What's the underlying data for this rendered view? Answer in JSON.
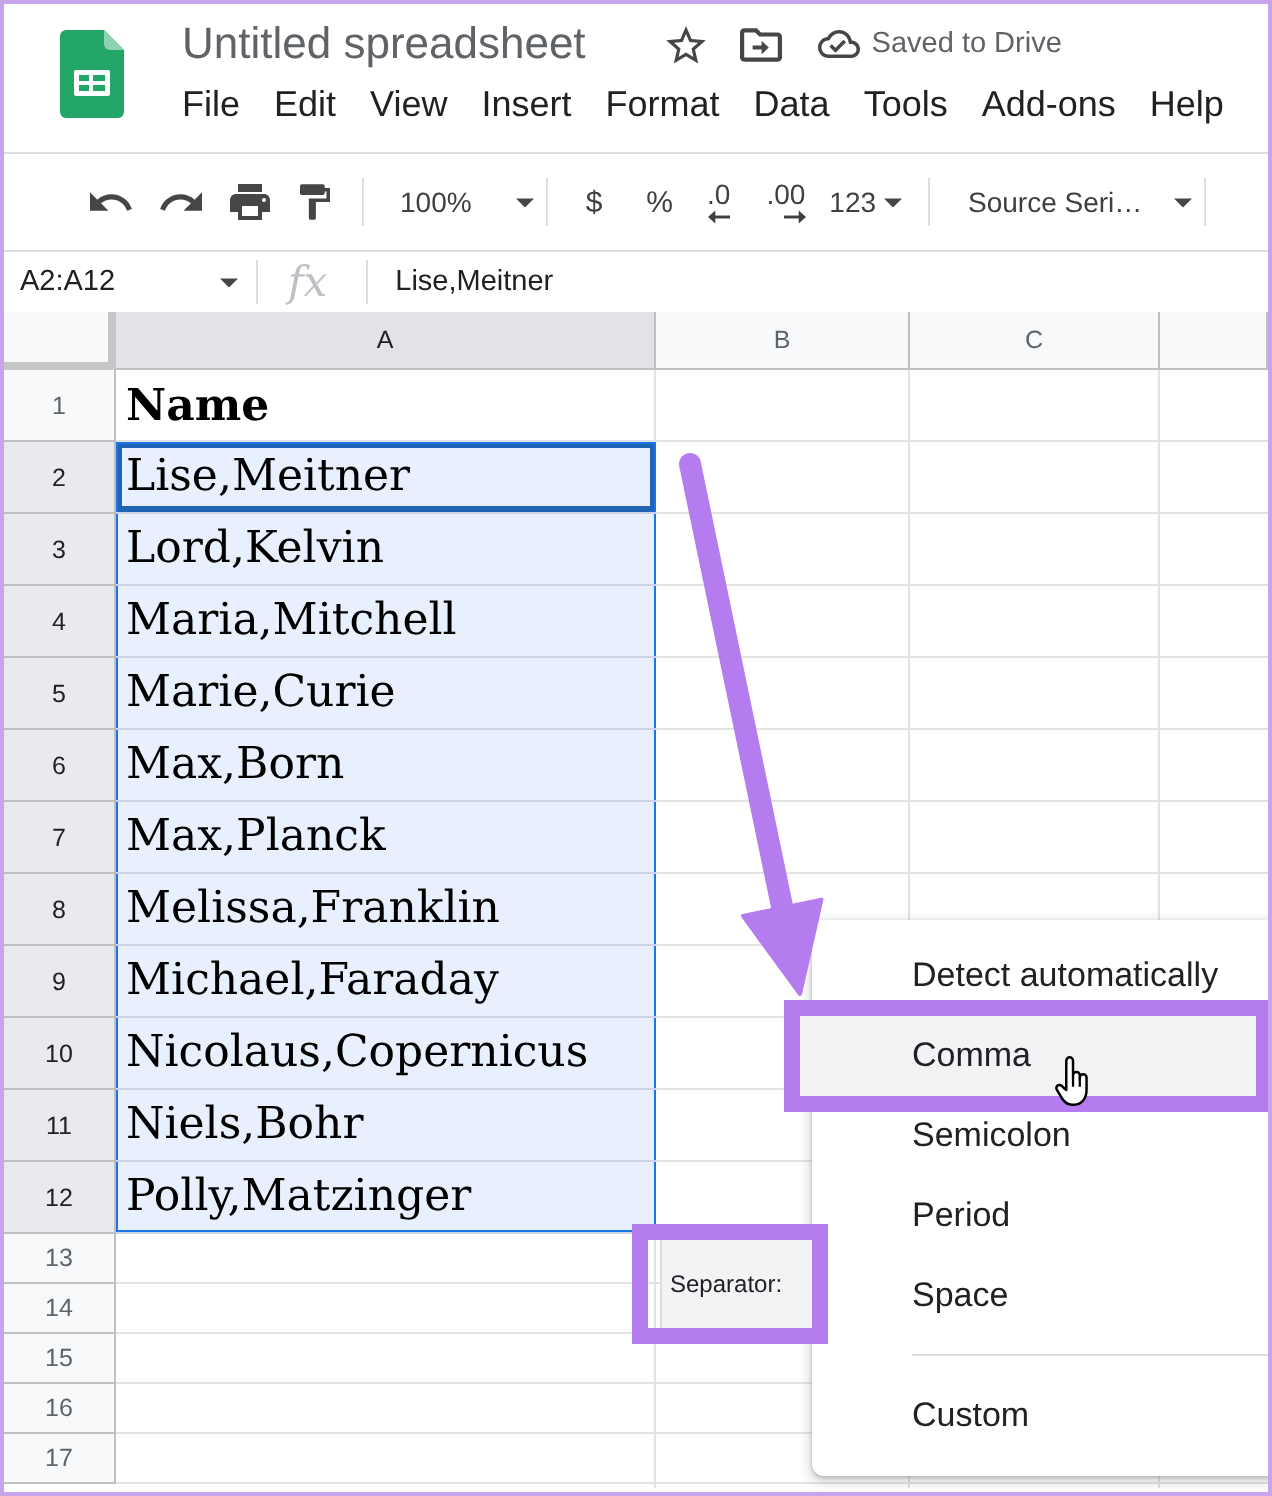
{
  "header": {
    "title": "Untitled spreadsheet",
    "save_status": "Saved to Drive",
    "menu": [
      "File",
      "Edit",
      "View",
      "Insert",
      "Format",
      "Data",
      "Tools",
      "Add-ons",
      "Help"
    ]
  },
  "toolbar": [
    {
      "kind": "undo"
    },
    {
      "kind": "redo"
    },
    {
      "kind": "print"
    },
    {
      "kind": "paint_format"
    },
    {
      "kind": "divider"
    },
    {
      "kind": "zoom",
      "label": "100%"
    },
    {
      "kind": "divider"
    },
    {
      "kind": "text",
      "label": "$"
    },
    {
      "kind": "text",
      "label": "%"
    },
    {
      "kind": "decimal_decrease",
      "label": ".0"
    },
    {
      "kind": "decimal_increase",
      "label": ".00"
    },
    {
      "kind": "number_format",
      "label": "123"
    },
    {
      "kind": "divider"
    },
    {
      "kind": "font",
      "label": "Source Seri…"
    },
    {
      "kind": "divider"
    }
  ],
  "formula_bar": {
    "name_box": "A2:A12",
    "function_label": "fx",
    "formula": "Lise,Meitner"
  },
  "sheet": {
    "columns": [
      {
        "label": "A",
        "selected": true
      },
      {
        "label": "B",
        "selected": false
      },
      {
        "label": "C",
        "selected": false
      }
    ],
    "rows": [
      {
        "label": "1",
        "kind": "header",
        "value": "Name",
        "selected": false,
        "active": false
      },
      {
        "label": "2",
        "kind": "text",
        "value": "Lise,Meitner",
        "selected": true,
        "active": true
      },
      {
        "label": "3",
        "kind": "text",
        "value": "Lord,Kelvin",
        "selected": true,
        "active": false
      },
      {
        "label": "4",
        "kind": "text",
        "value": "Maria,Mitchell",
        "selected": true,
        "active": false
      },
      {
        "label": "5",
        "kind": "text",
        "value": "Marie,Curie",
        "selected": true,
        "active": false
      },
      {
        "label": "6",
        "kind": "text",
        "value": "Max,Born",
        "selected": true,
        "active": false
      },
      {
        "label": "7",
        "kind": "text",
        "value": "Max,Planck",
        "selected": true,
        "active": false
      },
      {
        "label": "8",
        "kind": "text",
        "value": "Melissa,Franklin",
        "selected": true,
        "active": false
      },
      {
        "label": "9",
        "kind": "text",
        "value": "Michael,Faraday",
        "selected": true,
        "active": false
      },
      {
        "label": "10",
        "kind": "text",
        "value": "Nicolaus,Copernicus",
        "selected": true,
        "active": false
      },
      {
        "label": "11",
        "kind": "text",
        "value": "Niels,Bohr",
        "selected": true,
        "active": false
      },
      {
        "label": "12",
        "kind": "text",
        "value": "Polly,Matzinger",
        "selected": true,
        "active": false
      },
      {
        "label": "13",
        "kind": "empty",
        "selected": false,
        "active": false
      },
      {
        "label": "14",
        "kind": "empty",
        "selected": false,
        "active": false
      },
      {
        "label": "15",
        "kind": "empty",
        "selected": false,
        "active": false
      },
      {
        "label": "16",
        "kind": "empty",
        "selected": false,
        "active": false
      },
      {
        "label": "17",
        "kind": "empty",
        "selected": false,
        "active": false
      }
    ]
  },
  "paste_chip": {
    "label": "Separator:",
    "highlighted": true
  },
  "separator_menu": {
    "items": [
      {
        "kind": "option",
        "label": "Detect automatically",
        "selected": false,
        "highlighted": false
      },
      {
        "kind": "option",
        "label": "Comma",
        "selected": true,
        "highlighted": true
      },
      {
        "kind": "option",
        "label": "Semicolon",
        "selected": false,
        "highlighted": false
      },
      {
        "kind": "option",
        "label": "Period",
        "selected": false,
        "highlighted": false
      },
      {
        "kind": "option",
        "label": "Space",
        "selected": false,
        "highlighted": false
      },
      {
        "kind": "divider"
      },
      {
        "kind": "option",
        "label": "Custom",
        "selected": false,
        "highlighted": false
      }
    ]
  }
}
